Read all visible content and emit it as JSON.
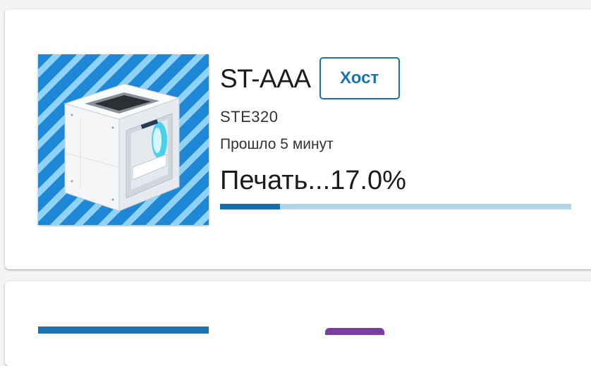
{
  "printer": {
    "name": "ST-AAA",
    "host_label": "Хост",
    "model": "STE320",
    "elapsed": "Прошло 5 минут",
    "status": "Печать...17.0%",
    "progress": 0.17,
    "image_icon": "3d-printer-image"
  },
  "colors": {
    "accent": "#1a73b0",
    "progress_track": "#b3d4e6",
    "progress_fill": "#156ea8",
    "stripe_dark": "#1e88d6",
    "stripe_light": "#8fd3f7"
  }
}
